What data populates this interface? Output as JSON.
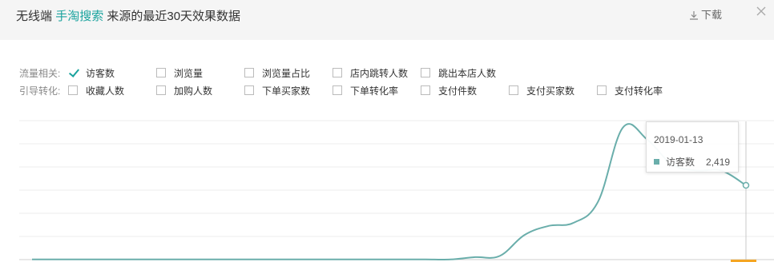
{
  "header": {
    "title_prefix": "无线端",
    "title_accent": "手淘搜索",
    "title_suffix": "来源的最近30天效果数据",
    "download_label": "下载",
    "accent_color": "#1aa39e"
  },
  "filters": {
    "row1": {
      "label": "流量相关:",
      "options": [
        {
          "label": "访客数",
          "checked": true
        },
        {
          "label": "浏览量",
          "checked": false
        },
        {
          "label": "浏览量占比",
          "checked": false
        },
        {
          "label": "店内跳转人数",
          "checked": false
        },
        {
          "label": "跳出本店人数",
          "checked": false
        }
      ]
    },
    "row2": {
      "label": "引导转化:",
      "options": [
        {
          "label": "收藏人数",
          "checked": false
        },
        {
          "label": "加购人数",
          "checked": false
        },
        {
          "label": "下单买家数",
          "checked": false
        },
        {
          "label": "下单转化率",
          "checked": false
        },
        {
          "label": "支付件数",
          "checked": false
        },
        {
          "label": "支付买家数",
          "checked": false
        },
        {
          "label": "支付转化率",
          "checked": false
        }
      ]
    }
  },
  "tooltip": {
    "date": "2019-01-13",
    "series_name": "访客数",
    "value": "2,419"
  },
  "chart_data": {
    "type": "line",
    "series": [
      {
        "name": "访客数",
        "color": "#6aaeab",
        "values": [
          5,
          5,
          5,
          5,
          5,
          5,
          5,
          5,
          5,
          5,
          5,
          5,
          5,
          5,
          5,
          5,
          5,
          5,
          80,
          120,
          800,
          1100,
          1200,
          1900,
          4300,
          3900,
          3100,
          2900,
          2900,
          2419
        ]
      }
    ],
    "grid": true
  }
}
